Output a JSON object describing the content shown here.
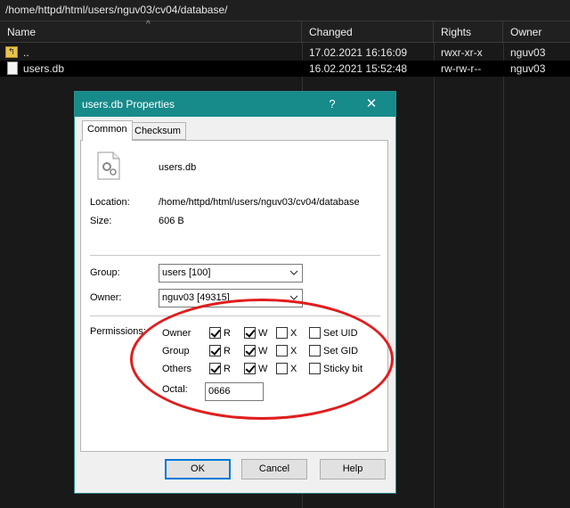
{
  "path": "/home/httpd/html/users/nguv03/cv04/database/",
  "columns": {
    "name": "Name",
    "changed": "Changed",
    "rights": "Rights",
    "owner": "Owner"
  },
  "files": [
    {
      "name": "..",
      "changed": "17.02.2021 16:16:09",
      "rights": "rwxr-xr-x",
      "owner": "nguv03",
      "icon": "parent-folder-icon"
    },
    {
      "name": "users.db",
      "changed": "16.02.2021 15:52:48",
      "rights": "rw-rw-r--",
      "owner": "nguv03",
      "icon": "file-icon"
    }
  ],
  "dialog": {
    "title": "users.db Properties",
    "help_glyph": "?",
    "close_glyph": "✕",
    "tabs": [
      "Common",
      "Checksum"
    ],
    "file_name": "users.db",
    "location_label": "Location:",
    "location": "/home/httpd/html/users/nguv03/cv04/database",
    "size_label": "Size:",
    "size": "606 B",
    "group_label": "Group:",
    "group": "users [100]",
    "owner_label": "Owner:",
    "owner": "nguv03 [49315]",
    "permissions_label": "Permissions:",
    "perm_rows": [
      "Owner",
      "Group",
      "Others"
    ],
    "perm_cols": [
      "R",
      "W",
      "X"
    ],
    "special": [
      "Set UID",
      "Set GID",
      "Sticky bit"
    ],
    "octal_label": "Octal:",
    "octal": "0666",
    "buttons": {
      "ok": "OK",
      "cancel": "Cancel",
      "help": "Help"
    }
  },
  "colors": {
    "accent": "#178a8a",
    "highlight": "#e01e1e"
  }
}
